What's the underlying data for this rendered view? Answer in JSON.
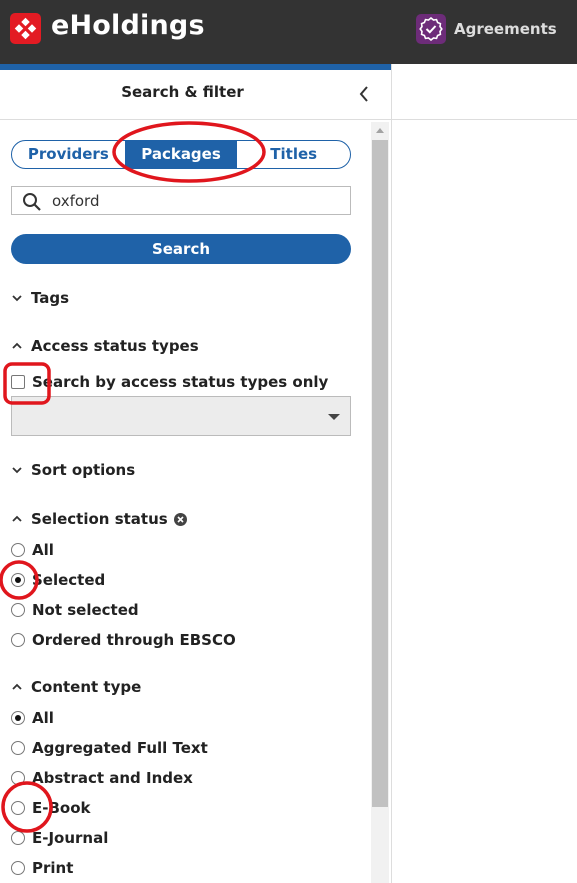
{
  "app": {
    "title": "eHoldings",
    "logo_icon": "ebsco-cross-icon",
    "switcher_label": "Agreements",
    "switcher_icon": "badge-check-icon"
  },
  "colors": {
    "topbar": "#333333",
    "accent": "#1f62a8",
    "logo_red": "#e31b23",
    "agreements_purple": "#6d2c79",
    "annotation_red": "#e0161d"
  },
  "pane": {
    "title": "Search & filter",
    "collapse_icon": "chevron-left-icon"
  },
  "segment": {
    "items": [
      {
        "label": "Providers",
        "active": false
      },
      {
        "label": "Packages",
        "active": true
      },
      {
        "label": "Titles",
        "active": false
      }
    ]
  },
  "search": {
    "value": "oxford",
    "icon": "search-icon",
    "button_label": "Search"
  },
  "filters": {
    "tags": {
      "label": "Tags",
      "expanded": false
    },
    "access_status": {
      "label": "Access status types",
      "expanded": true,
      "checkbox_label": "Search by access status types only",
      "checkbox_checked": false,
      "select_value": ""
    },
    "sort": {
      "label": "Sort options",
      "expanded": false
    },
    "selection_status": {
      "label": "Selection status",
      "clear_icon": "clear-circle-icon",
      "expanded": true,
      "options": [
        {
          "label": "All",
          "checked": false
        },
        {
          "label": "Selected",
          "checked": true
        },
        {
          "label": "Not selected",
          "checked": false
        },
        {
          "label": "Ordered through EBSCO",
          "checked": false
        }
      ]
    },
    "content_type": {
      "label": "Content type",
      "expanded": true,
      "options": [
        {
          "label": "All",
          "checked": true
        },
        {
          "label": "Aggregated Full Text",
          "checked": false
        },
        {
          "label": "Abstract and Index",
          "checked": false
        },
        {
          "label": "E-Book",
          "checked": false
        },
        {
          "label": "E-Journal",
          "checked": false
        },
        {
          "label": "Print",
          "checked": false
        }
      ]
    }
  }
}
